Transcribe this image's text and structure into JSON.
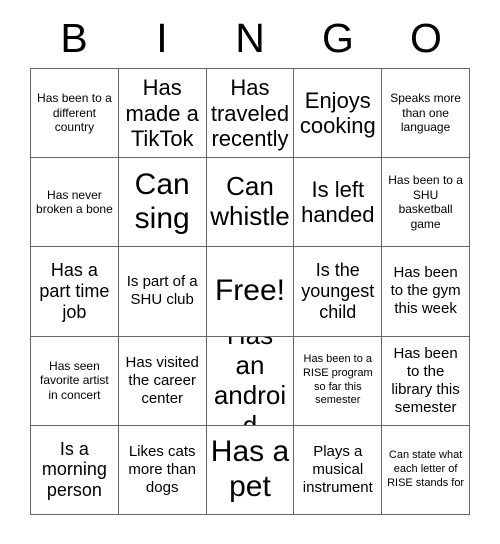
{
  "card": {
    "title": "BINGO",
    "header_letters": [
      "B",
      "I",
      "N",
      "G",
      "O"
    ],
    "columns": 5,
    "rows": 5,
    "free_space_index": 12,
    "colors": {
      "background": "#ffffff",
      "text": "#000000",
      "grid_line": "#666666"
    },
    "cells": [
      {
        "text": "Has been to a different country",
        "size": "xs"
      },
      {
        "text": "Has made a TikTok",
        "size": "lg"
      },
      {
        "text": "Has traveled recently",
        "size": "lg"
      },
      {
        "text": "Enjoys cooking",
        "size": "lg"
      },
      {
        "text": "Speaks more than one language",
        "size": "xs"
      },
      {
        "text": "Has never broken a bone",
        "size": "xs"
      },
      {
        "text": "Can sing",
        "size": "xxl"
      },
      {
        "text": "Can whistle",
        "size": "xl"
      },
      {
        "text": "Is left handed",
        "size": "lg"
      },
      {
        "text": "Has been to a SHU basketball game",
        "size": "xs"
      },
      {
        "text": "Has a part time job",
        "size": "md"
      },
      {
        "text": "Is part of a SHU club",
        "size": "sm"
      },
      {
        "text": "Free!",
        "size": "xxl"
      },
      {
        "text": "Is the youngest child",
        "size": "md"
      },
      {
        "text": "Has been to the gym this week",
        "size": "sm"
      },
      {
        "text": "Has seen favorite artist in concert",
        "size": "xs"
      },
      {
        "text": "Has visited the career center",
        "size": "sm"
      },
      {
        "text": "Has an android",
        "size": "xl"
      },
      {
        "text": "Has been to a RISE program so far this semester",
        "size": "xxs"
      },
      {
        "text": "Has been to the library this semester",
        "size": "sm"
      },
      {
        "text": "Is a morning person",
        "size": "md"
      },
      {
        "text": "Likes cats more than dogs",
        "size": "sm"
      },
      {
        "text": "Has a pet",
        "size": "xxl"
      },
      {
        "text": "Plays a musical instrument",
        "size": "sm"
      },
      {
        "text": "Can state what each letter of RISE stands for",
        "size": "xxs"
      }
    ]
  }
}
